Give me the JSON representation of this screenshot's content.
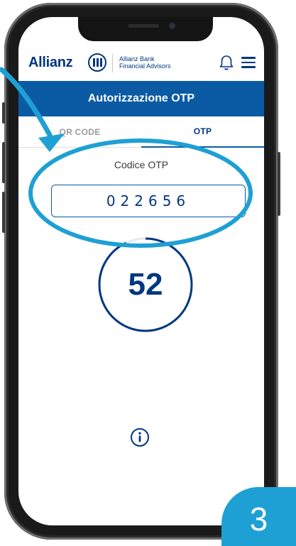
{
  "header": {
    "brand": "Allianz",
    "bank_line1": "Allianz Bank",
    "bank_line2": "Financial Advisors"
  },
  "title": "Autorizzazione OTP",
  "tabs": [
    {
      "label": "QR CODE",
      "active": false
    },
    {
      "label": "OTP",
      "active": true
    }
  ],
  "otp": {
    "label": "Codice OTP",
    "code": "022656"
  },
  "timer": {
    "seconds": "52",
    "remaining_fraction": 0.93
  },
  "step": "3",
  "colors": {
    "brand_blue": "#003781",
    "bar_blue": "#0b5aa4",
    "highlight": "#1ea0d4"
  },
  "icons": [
    "allianz-logo-icon",
    "bell-icon",
    "hamburger-menu-icon",
    "info-icon",
    "pointer-arrow-icon"
  ]
}
